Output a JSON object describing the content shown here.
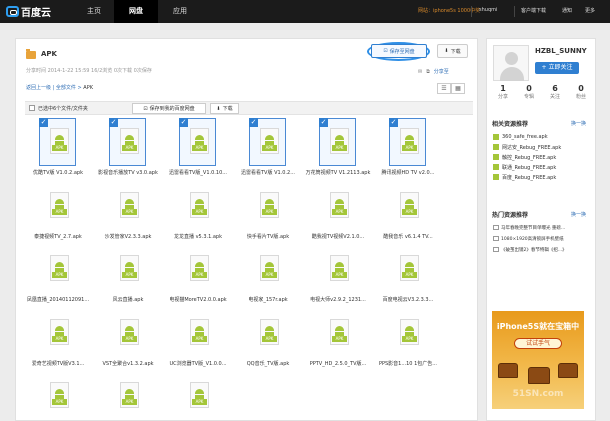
{
  "topbar": {
    "logo": "百度云",
    "nav": [
      "主页",
      "网盘",
      "应用"
    ],
    "promo": "网站：iphone5s 1000中奖",
    "user": "shuqmi",
    "links": [
      "客户端下载",
      "通知",
      "更多"
    ]
  },
  "folder": {
    "title": "APK",
    "meta": "分享时间 2014-1-22 15:59 16/2浏览 0次下载 0次保存",
    "save_label": "保存至网盘",
    "download_label": "下载",
    "share_label": "分享至"
  },
  "breadcrumb": {
    "back": "返回上一级",
    "all": "全部文件",
    "current": "APK"
  },
  "select_bar": {
    "select_text": "已选中6个文件/文件夹",
    "save_label": "保存到我的百度网盘",
    "download_label": "下载"
  },
  "files": [
    {
      "name": "优酷TV版 V1.0.2.apk",
      "selected": true
    },
    {
      "name": "影视音乐播放TV v3.0.apk",
      "selected": true
    },
    {
      "name": "迅雷看看TV版_V1.0.10...",
      "selected": true
    },
    {
      "name": "迅雷看看TV版 V1.0.2...",
      "selected": true
    },
    {
      "name": "万花筒视频TV V1.2113.apk",
      "selected": true
    },
    {
      "name": "腾讯视频HD TV v2.0...",
      "selected": true
    },
    {
      "name": "泰捷视频TV_2.7.apk",
      "selected": false
    },
    {
      "name": "沙发管家V2.3.3.apk",
      "selected": false
    },
    {
      "name": "龙龙直播 v5.3.1.apk",
      "selected": false
    },
    {
      "name": "快手看片TV版.apk",
      "selected": false
    },
    {
      "name": "酷我视TV视频V2.1.0...",
      "selected": false
    },
    {
      "name": "酷我音乐 v6.1.4 TV...",
      "selected": false
    },
    {
      "name": "凤凰直播_20140112091...",
      "selected": false
    },
    {
      "name": "风云直播.apk",
      "selected": false
    },
    {
      "name": "电视猫MoreTV2.0.0.apk",
      "selected": false
    },
    {
      "name": "电视家_157r.apk",
      "selected": false
    },
    {
      "name": "电视大师v2.9.2_1231...",
      "selected": false
    },
    {
      "name": "百度电视云V3.2.3.3...",
      "selected": false
    },
    {
      "name": "爱奇艺视频TV版V3.1...",
      "selected": false
    },
    {
      "name": "VST全聚合v1.3.2.apk",
      "selected": false
    },
    {
      "name": "UC浏览器TV版_V1.0.0...",
      "selected": false
    },
    {
      "name": "QQ音乐_TV版.apk",
      "selected": false
    },
    {
      "name": "PPTV_HD_2.5.0_TV版...",
      "selected": false
    },
    {
      "name": "PPS影音1...10 1包广告...",
      "selected": false
    },
    {
      "name": "onlinetv.apk",
      "selected": false
    },
    {
      "name": "LetClient_Crack_Ba...",
      "selected": false
    },
    {
      "name": "360电视卫士v2.0.8.apk",
      "selected": false
    }
  ],
  "profile": {
    "name": "HZBL_SUNNY",
    "follow_label": "+ 立即关注",
    "stats": [
      {
        "n": "1",
        "l": "分享"
      },
      {
        "n": "0",
        "l": "专辑"
      },
      {
        "n": "6",
        "l": "关注"
      },
      {
        "n": "0",
        "l": "粉丝"
      }
    ]
  },
  "related": {
    "title": "相关资源推荐",
    "more": "换一换",
    "items": [
      "360_safe_free.apk",
      "网达安_Rebug_FREE.apk",
      "触控_Rebug_FREE.apk",
      "联通_Rebug_FREE.apk",
      "百度_Rebug_FREE.apk"
    ]
  },
  "hot": {
    "title": "热门资源推荐",
    "more": "换一换",
    "items": [
      "马年春晚完整节目单曝光 重磅...",
      "1080×1920高清锁屏手机壁纸",
      "《破茧出镜2》春节特辑《招...》"
    ]
  },
  "ad": {
    "title": "iPhone5S就在宝箱中",
    "button": "试试手气",
    "footer": "51SN.com"
  }
}
